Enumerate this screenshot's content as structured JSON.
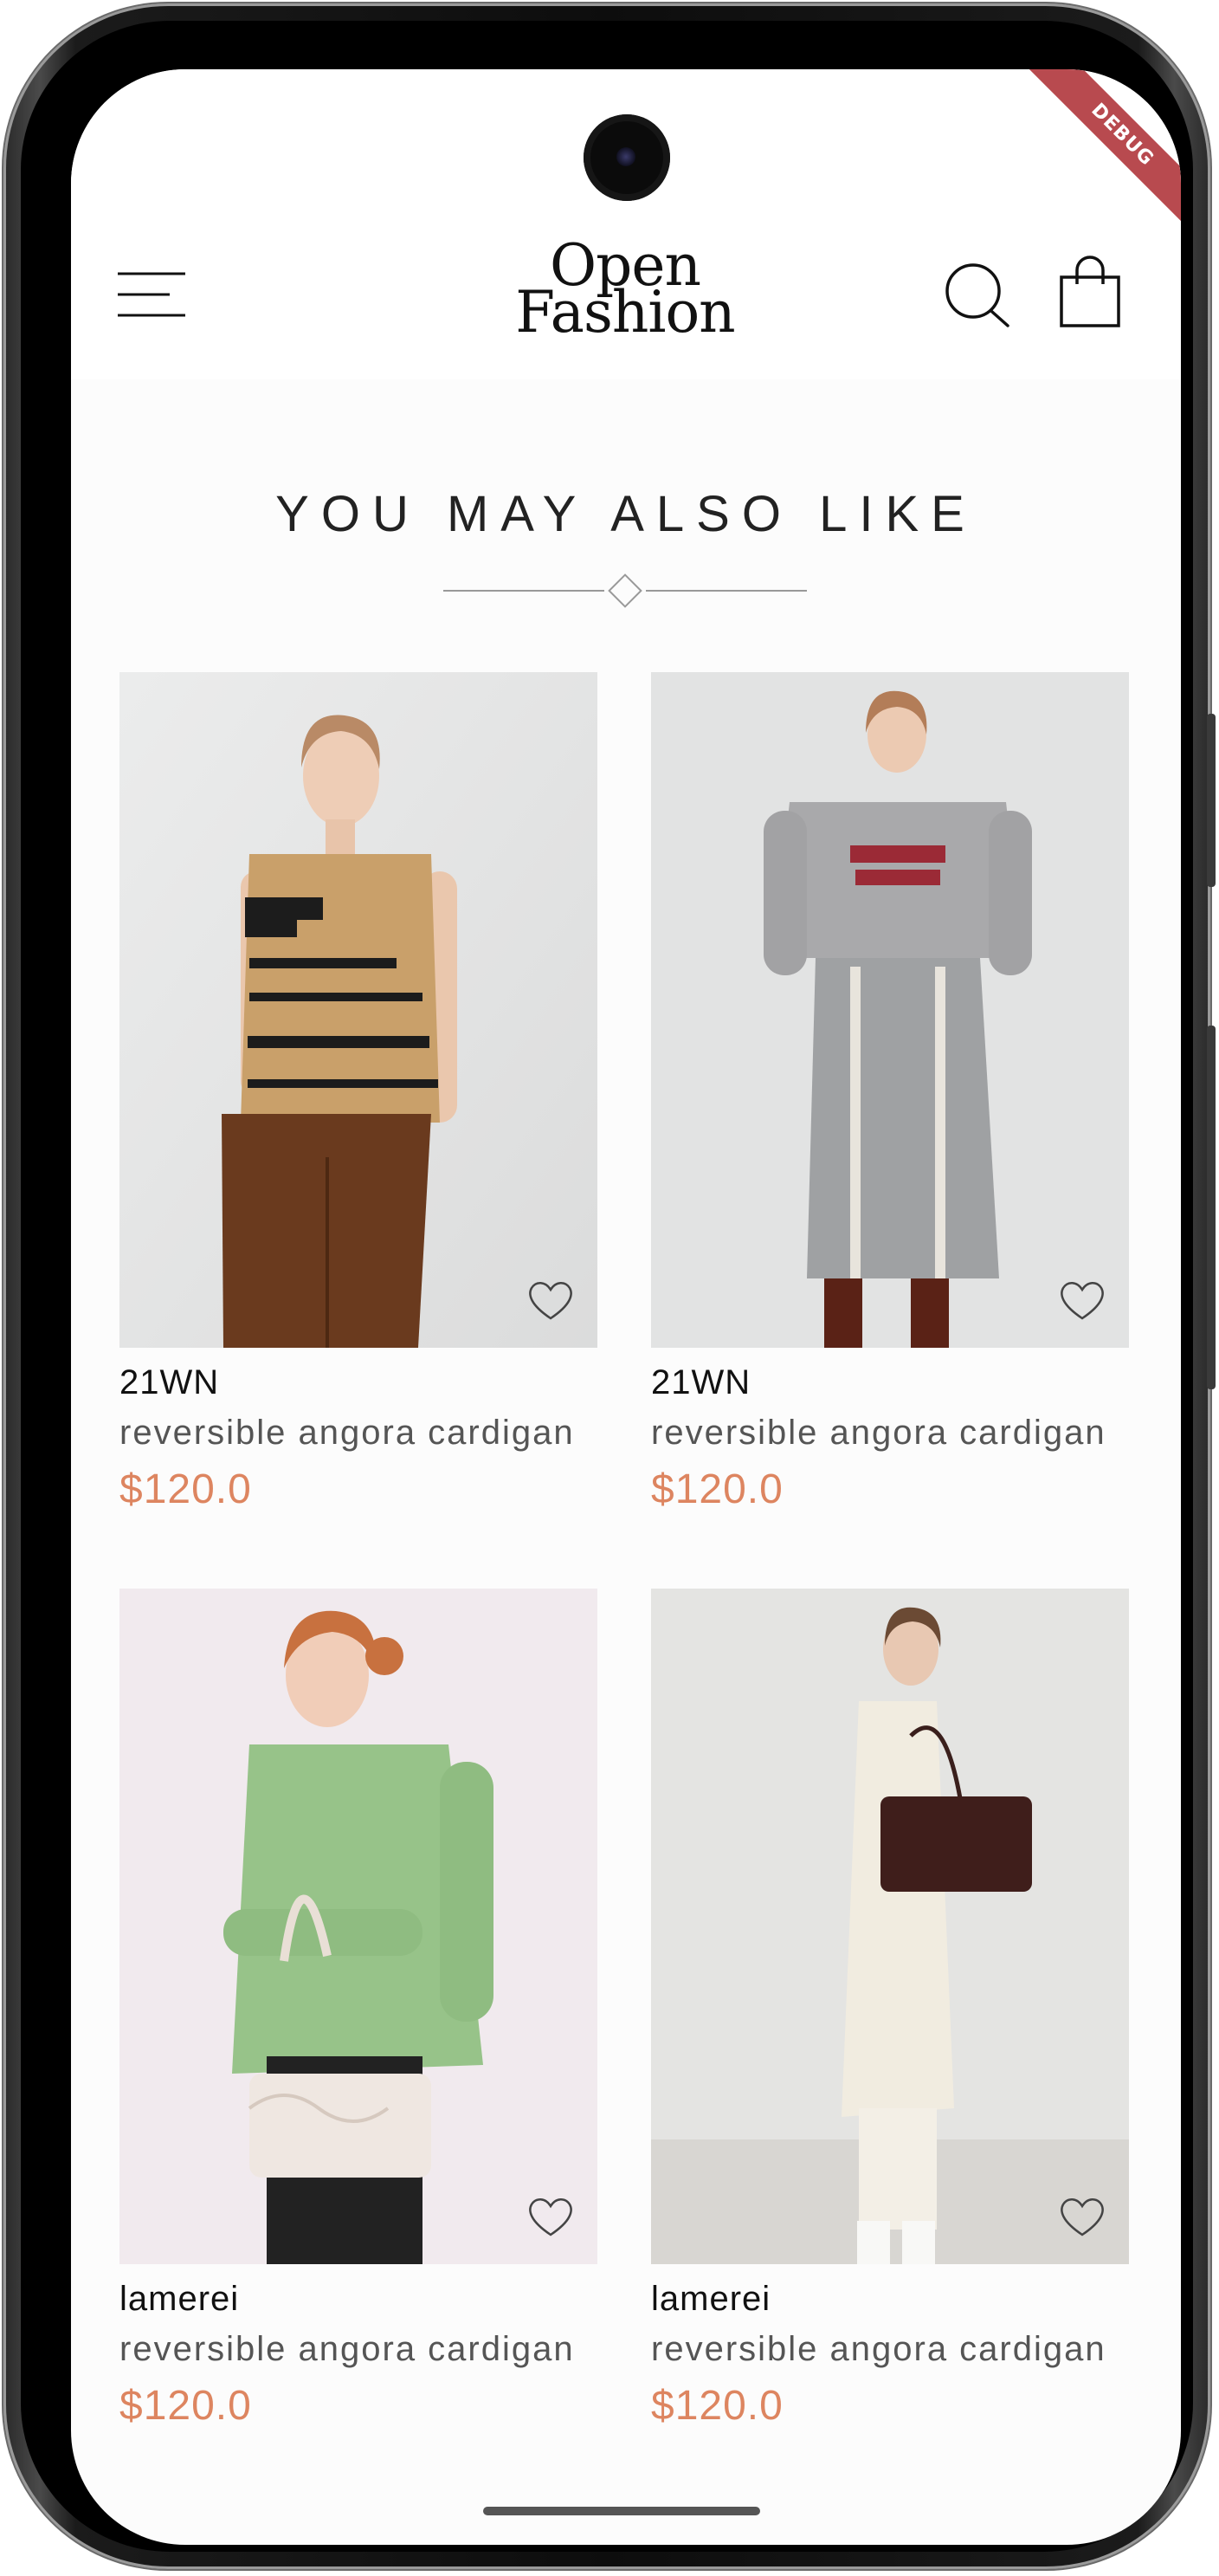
{
  "app": {
    "logo_line1": "Open",
    "logo_line2": "Fashion",
    "debug_label": "DEBUG"
  },
  "header": {
    "menu_icon": "hamburger-menu-icon",
    "search_icon": "search-icon",
    "bag_icon": "shopping-bag-icon"
  },
  "section": {
    "title": "YOU MAY ALSO LIKE"
  },
  "products": [
    {
      "brand": "21WN",
      "name": "reversible angora cardigan",
      "price": "$120.0",
      "photo": "model-knit-vest-corduroy-pants"
    },
    {
      "brand": "21WN",
      "name": "reversible angora cardigan",
      "price": "$120.0",
      "photo": "model-grey-sweatshirt-skirt"
    },
    {
      "brand": "lamerei",
      "name": "reversible angora cardigan",
      "price": "$120.0",
      "photo": "model-green-cardigan-handbag"
    },
    {
      "brand": "lamerei",
      "name": "reversible angora cardigan",
      "price": "$120.0",
      "photo": "model-cream-coat-tote"
    }
  ],
  "colors": {
    "accent_price": "#dd8560",
    "debug_ribbon": "#b84a4f",
    "background": "#fcfcfc"
  }
}
